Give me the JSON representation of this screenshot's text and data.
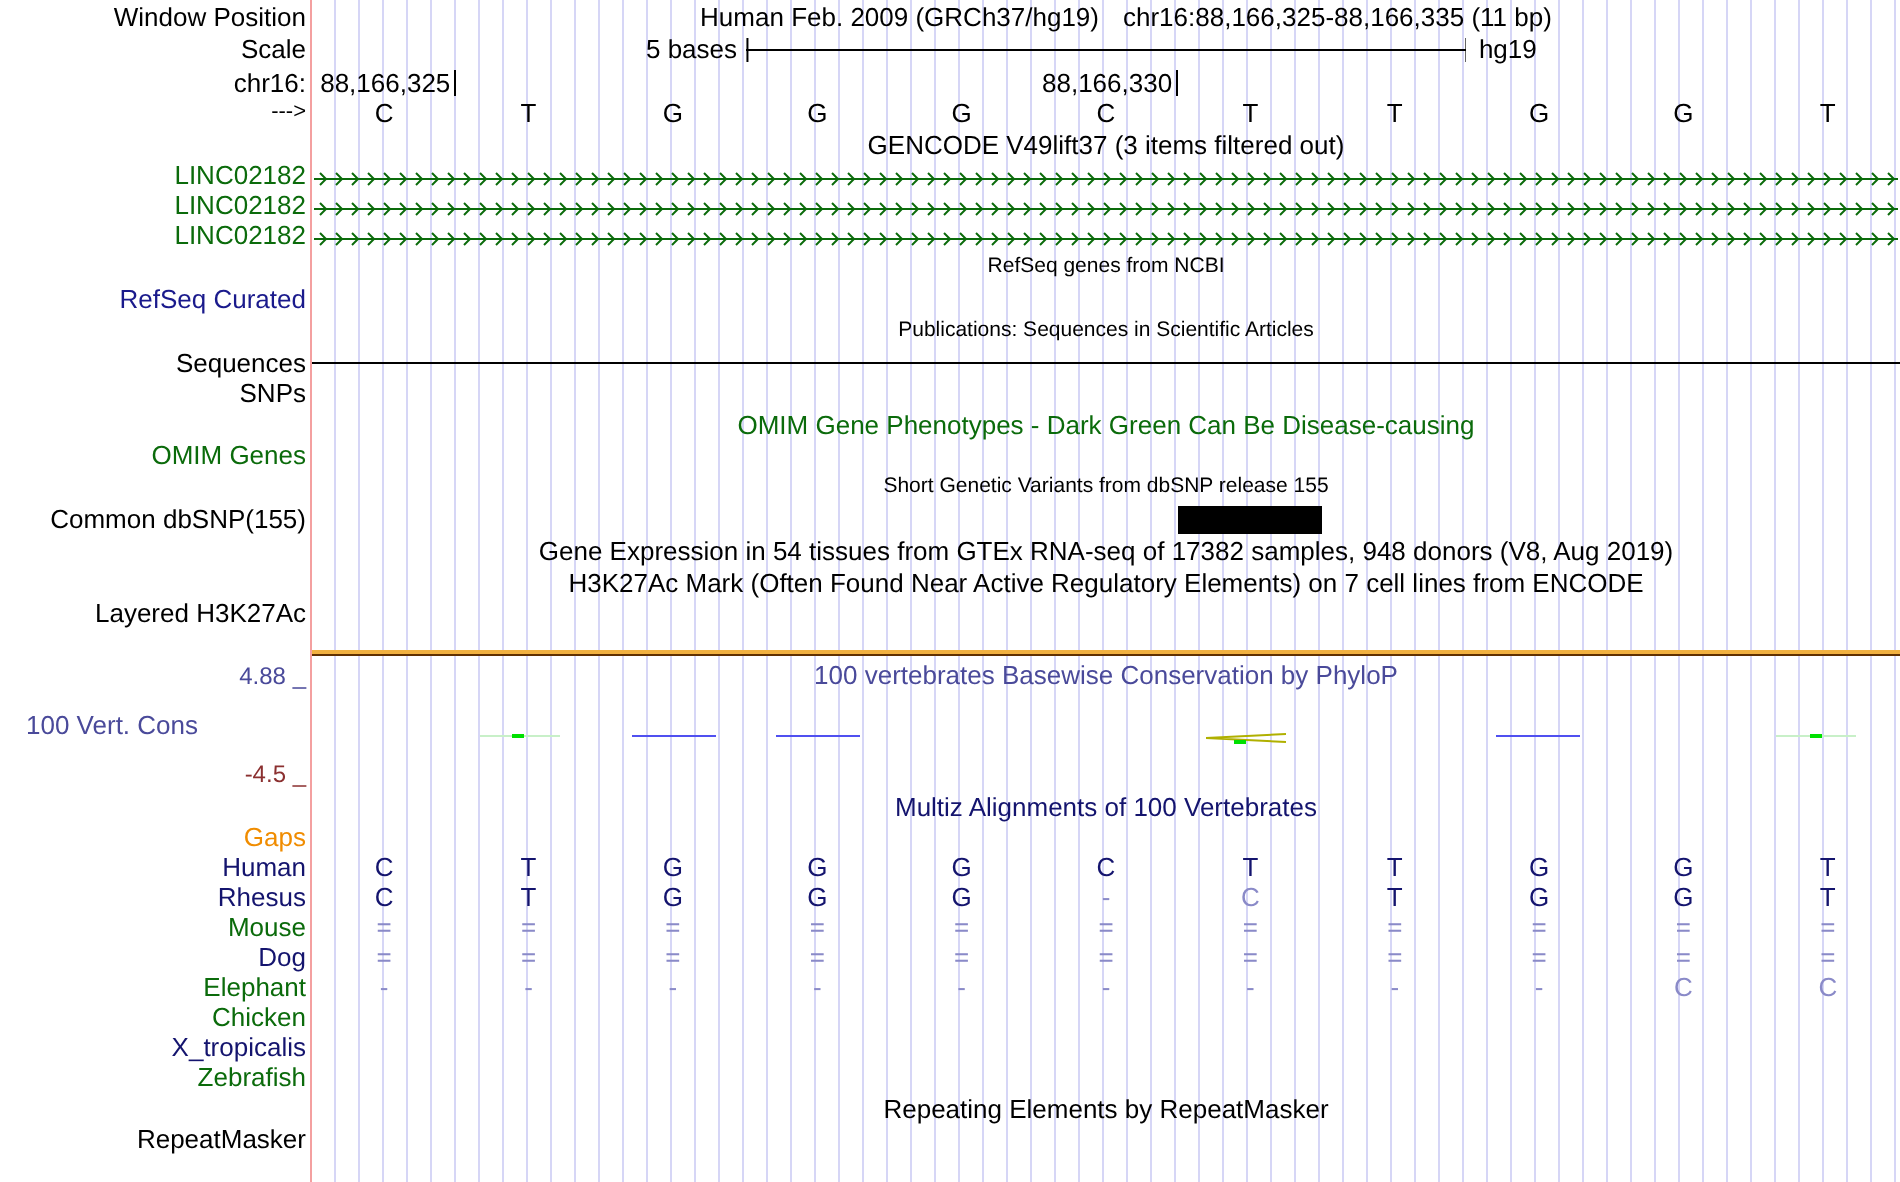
{
  "window_position": {
    "label": "Window Position",
    "assembly": "Human Feb. 2009 (GRCh37/hg19)",
    "position": "chr16:88,166,325-88,166,335 (11 bp)"
  },
  "scale": {
    "label": "Scale",
    "length": "5 bases",
    "assembly": "hg19"
  },
  "ruler": {
    "label": "chr16:",
    "ticks": [
      "88,166,325",
      "88,166,330"
    ]
  },
  "sequence": {
    "label": "--->",
    "bases": [
      "C",
      "T",
      "G",
      "G",
      "G",
      "C",
      "T",
      "T",
      "G",
      "G",
      "T"
    ]
  },
  "tracks": [
    {
      "kind": "title",
      "text": "GENCODE V49lift37 (3 items filtered out)",
      "color": "#000000"
    },
    {
      "kind": "gene",
      "label": "LINC02182",
      "color": "#0b6b0b"
    },
    {
      "kind": "gene",
      "label": "LINC02182",
      "color": "#0b6b0b"
    },
    {
      "kind": "gene",
      "label": "LINC02182",
      "color": "#0b6b0b"
    },
    {
      "kind": "small_title",
      "text": "RefSeq genes from NCBI"
    },
    {
      "kind": "label",
      "label": "RefSeq Curated",
      "color": "#1a1a8c"
    },
    {
      "kind": "small_title",
      "text": "Publications: Sequences in Scientific Articles"
    },
    {
      "kind": "line",
      "label": "Sequences",
      "color": "#000000"
    },
    {
      "kind": "label",
      "label": "SNPs",
      "color": "#000000"
    },
    {
      "kind": "title",
      "text": "OMIM Gene Phenotypes - Dark Green Can Be Disease-causing",
      "color": "#0b6b0b"
    },
    {
      "kind": "label",
      "label": "OMIM Genes",
      "color": "#0b6b0b"
    },
    {
      "kind": "small_title",
      "text": "Short Genetic Variants from dbSNP release 155"
    },
    {
      "kind": "block",
      "label": "Common dbSNP(155)",
      "color": "#000000"
    },
    {
      "kind": "title",
      "text": "Gene Expression in 54 tissues from GTEx RNA-seq of 17382 samples, 948 donors (V8, Aug 2019)",
      "color": "#000000"
    },
    {
      "kind": "title",
      "text": "H3K27Ac Mark (Often Found Near Active Regulatory Elements) on 7 cell lines from ENCODE",
      "color": "#000000"
    },
    {
      "kind": "label",
      "label": "Layered H3K27Ac",
      "color": "#000000"
    },
    {
      "kind": "separator"
    },
    {
      "kind": "wiggle",
      "label": "100 Vert. Cons",
      "title": "100 vertebrates Basewise Conservation by PhyloP",
      "max": "4.88 _",
      "min": "-4.5 _"
    },
    {
      "kind": "title",
      "text": "Multiz Alignments of 100 Vertebrates",
      "color": "#14146e"
    },
    {
      "kind": "label",
      "label": "Gaps",
      "color": "#f08c00"
    },
    {
      "kind": "alignment",
      "label": "Human",
      "color": "#14146e",
      "cells": [
        {
          "text": "C",
          "faded": false
        },
        {
          "text": "T",
          "faded": false
        },
        {
          "text": "G",
          "faded": false
        },
        {
          "text": "G",
          "faded": false
        },
        {
          "text": "G",
          "faded": false
        },
        {
          "text": "C",
          "faded": false
        },
        {
          "text": "T",
          "faded": false
        },
        {
          "text": "T",
          "faded": false
        },
        {
          "text": "G",
          "faded": false
        },
        {
          "text": "G",
          "faded": false
        },
        {
          "text": "T",
          "faded": false
        }
      ]
    },
    {
      "kind": "alignment",
      "label": "Rhesus",
      "color": "#14146e",
      "cells": [
        {
          "text": "C",
          "faded": false
        },
        {
          "text": "T",
          "faded": false
        },
        {
          "text": "G",
          "faded": false
        },
        {
          "text": "G",
          "faded": false
        },
        {
          "text": "G",
          "faded": false
        },
        {
          "text": "-",
          "faded": true
        },
        {
          "text": "C",
          "faded": true
        },
        {
          "text": "T",
          "faded": false
        },
        {
          "text": "G",
          "faded": false
        },
        {
          "text": "G",
          "faded": false
        },
        {
          "text": "T",
          "faded": false
        }
      ]
    },
    {
      "kind": "alignment",
      "label": "Mouse",
      "color": "#0b6b0b",
      "cells": [
        {
          "text": "=",
          "faded": true
        },
        {
          "text": "=",
          "faded": true
        },
        {
          "text": "=",
          "faded": true
        },
        {
          "text": "=",
          "faded": true
        },
        {
          "text": "=",
          "faded": true
        },
        {
          "text": "=",
          "faded": true
        },
        {
          "text": "=",
          "faded": true
        },
        {
          "text": "=",
          "faded": true
        },
        {
          "text": "=",
          "faded": true
        },
        {
          "text": "=",
          "faded": true
        },
        {
          "text": "=",
          "faded": true
        }
      ]
    },
    {
      "kind": "alignment",
      "label": "Dog",
      "color": "#14146e",
      "cells": [
        {
          "text": "=",
          "faded": true
        },
        {
          "text": "=",
          "faded": true
        },
        {
          "text": "=",
          "faded": true
        },
        {
          "text": "=",
          "faded": true
        },
        {
          "text": "=",
          "faded": true
        },
        {
          "text": "=",
          "faded": true
        },
        {
          "text": "=",
          "faded": true
        },
        {
          "text": "=",
          "faded": true
        },
        {
          "text": "=",
          "faded": true
        },
        {
          "text": "=",
          "faded": true
        },
        {
          "text": "=",
          "faded": true
        }
      ]
    },
    {
      "kind": "alignment",
      "label": "Elephant",
      "color": "#0b6b0b",
      "cells": [
        {
          "text": "-",
          "faded": true
        },
        {
          "text": "-",
          "faded": true
        },
        {
          "text": "-",
          "faded": true
        },
        {
          "text": "-",
          "faded": true
        },
        {
          "text": "-",
          "faded": true
        },
        {
          "text": "-",
          "faded": true
        },
        {
          "text": "-",
          "faded": true
        },
        {
          "text": "-",
          "faded": true
        },
        {
          "text": "-",
          "faded": true
        },
        {
          "text": "C",
          "faded": true
        },
        {
          "text": "C",
          "faded": true
        }
      ]
    },
    {
      "kind": "alignment",
      "label": "Chicken",
      "color": "#0b6b0b"
    },
    {
      "kind": "alignment",
      "label": "X_tropicalis",
      "color": "#14146e"
    },
    {
      "kind": "alignment",
      "label": "Zebrafish",
      "color": "#0b6b0b"
    },
    {
      "kind": "title",
      "text": "Repeating Elements by RepeatMasker",
      "color": "#000000"
    },
    {
      "kind": "label",
      "label": "RepeatMasker",
      "color": "#000000"
    }
  ]
}
